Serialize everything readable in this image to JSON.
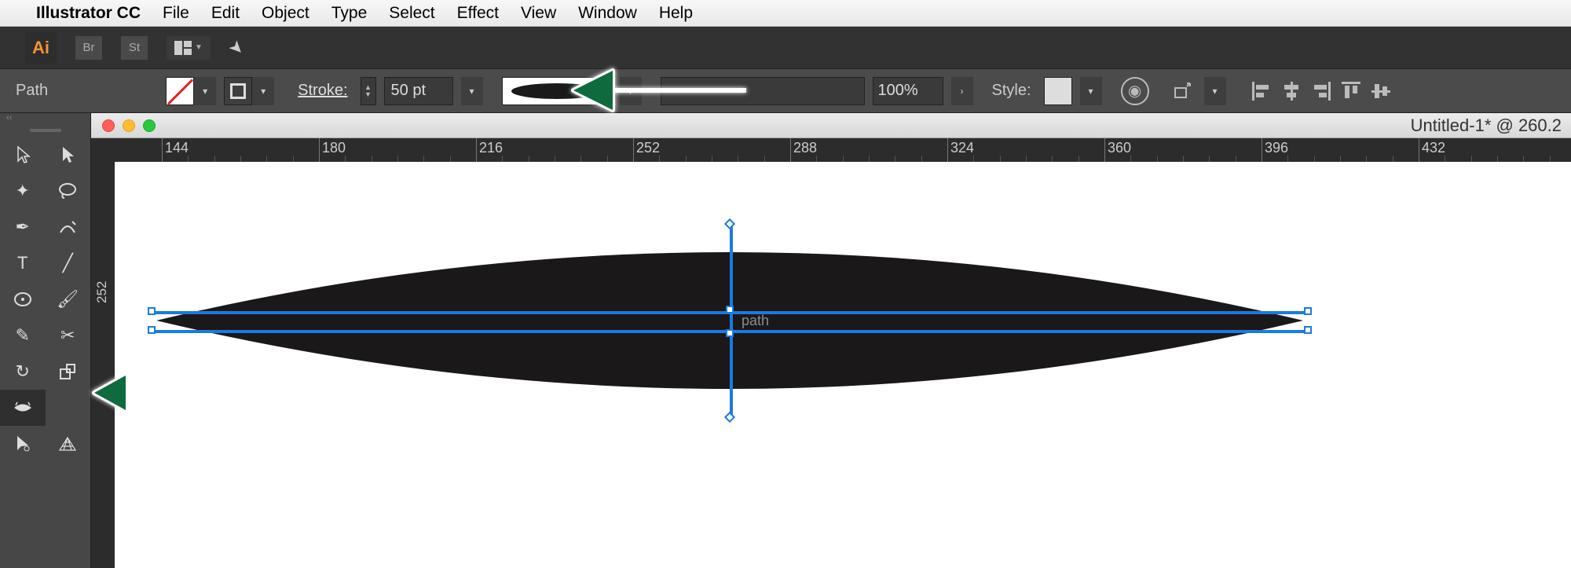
{
  "menubar": {
    "app": "Illustrator CC",
    "items": [
      "File",
      "Edit",
      "Object",
      "Type",
      "Select",
      "Effect",
      "View",
      "Window",
      "Help"
    ]
  },
  "apptop": {
    "logo": "Ai",
    "chip_br": "Br",
    "chip_st": "St"
  },
  "controlbar": {
    "selection_label": "Path",
    "stroke_label": "Stroke:",
    "stroke_weight": "50 pt",
    "opacity": "100%",
    "style_label": "Style:"
  },
  "document": {
    "title": "Untitled-1* @ 260.2",
    "path_label": "path"
  },
  "ruler": {
    "ticks": [
      "144",
      "180",
      "216",
      "252",
      "288",
      "324",
      "360",
      "396",
      "432"
    ],
    "vtick": "252"
  }
}
